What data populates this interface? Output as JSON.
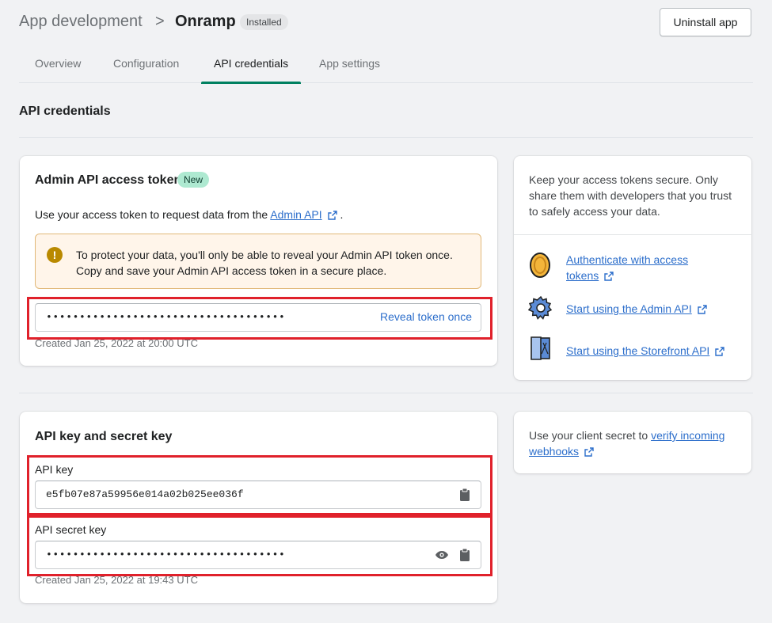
{
  "header": {
    "breadcrumb_parent": "App development",
    "breadcrumb_separator": ">",
    "app_name": "Onramp",
    "status_badge": "Installed",
    "uninstall_label": "Uninstall app"
  },
  "tabs": [
    {
      "label": "Overview",
      "active": false
    },
    {
      "label": "Configuration",
      "active": false
    },
    {
      "label": "API credentials",
      "active": true
    },
    {
      "label": "App settings",
      "active": false
    }
  ],
  "section_title": "API credentials",
  "admin_token_card": {
    "title": "Admin API access token",
    "new_badge": "New",
    "description_prefix": "Use your access token to request data from the",
    "description_link": "Admin API",
    "description_suffix": ".",
    "warning_line1": "To protect your data, you'll only be able to reveal your Admin API token once.",
    "warning_line2": "Copy and save your Admin API access token in a secure place.",
    "token_value": "••••••••••••••••••••••••••••••••••••",
    "reveal_label": "Reveal token once",
    "created": "Created Jan 25, 2022 at 20:00 UTC"
  },
  "help_card": {
    "text": "Keep your access tokens secure. Only share them with developers that you trust to safely access your data.",
    "links": [
      {
        "line1": "Authenticate with access",
        "line2": "tokens",
        "icon": "coin-icon"
      },
      {
        "label": "Start using the Admin API",
        "icon": "gear-icon"
      },
      {
        "label": "Start using the Storefront API",
        "icon": "storefront-icon"
      }
    ]
  },
  "keys_card": {
    "title": "API key and secret key",
    "api_key_label": "API key",
    "api_key_value": "e5fb07e87a59956e014a02b025ee036f",
    "secret_label": "API secret key",
    "secret_value": "••••••••••••••••••••••••••••••••••••",
    "created": "Created Jan 25, 2022 at 19:43 UTC"
  },
  "webhook_card": {
    "prefix": "Use your client secret to",
    "link_line1": "verify incoming",
    "link_line2": "webhooks"
  },
  "colors": {
    "accent": "#008060",
    "link": "#2c6ecb",
    "highlight": "#e0212b",
    "warning_bg": "#fff5ea"
  }
}
